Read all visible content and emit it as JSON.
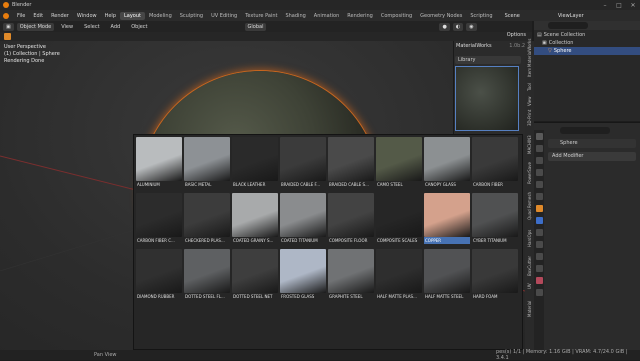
{
  "titlebar": {
    "title": "Blender",
    "minimize": "–",
    "maximize": "□",
    "close": "✕"
  },
  "menubar": {
    "menus": [
      "File",
      "Edit",
      "Render",
      "Window",
      "Help"
    ],
    "workspaces": [
      "Layout",
      "Modeling",
      "Sculpting",
      "UV Editing",
      "Texture Paint",
      "Shading",
      "Animation",
      "Rendering",
      "Compositing",
      "Geometry Nodes",
      "Scripting"
    ],
    "active_workspace": "Layout",
    "scene_label": "Scene",
    "viewlayer_label": "ViewLayer"
  },
  "viewport_header": {
    "mode": "Object Mode",
    "menus": [
      "View",
      "Select",
      "Add",
      "Object"
    ],
    "orientation": "Global",
    "options": "Options"
  },
  "viewport": {
    "info_lines": [
      "User Perspective",
      "(1) Collection | Sphere",
      "Rendering Done"
    ],
    "sidebar_tabs": [
      "MaterialWorks",
      "Item",
      "Tool",
      "View",
      "3D-Print",
      "MACHIN3",
      "PowerSave",
      "Quad Remesh",
      "HardOps",
      "BoxCutter",
      "UV",
      "Material"
    ]
  },
  "materialworks": {
    "title": "MaterialWorks",
    "version": "1.0b.2",
    "library_label": "Library"
  },
  "library": {
    "materials": [
      {
        "name": "ALUMINIUM",
        "color": "#b9bcbe"
      },
      {
        "name": "BASIC METAL",
        "color": "#8d9195"
      },
      {
        "name": "BLACK LEATHER",
        "color": "#2a2a2a"
      },
      {
        "name": "BRAIDED CABLE F...",
        "color": "#3b3b3b"
      },
      {
        "name": "BRAIDED CABLE S...",
        "color": "#4a4a4a"
      },
      {
        "name": "CAMO STEEL",
        "color": "#545a48"
      },
      {
        "name": "CANOPY GLASS",
        "color": "#8c9092"
      },
      {
        "name": "CARBON FIBER",
        "color": "#3a3a3a"
      },
      {
        "name": "CARBON FIBER C...",
        "color": "#2c2c2c"
      },
      {
        "name": "CHECKERED PLAS...",
        "color": "#3c3c3c"
      },
      {
        "name": "COATED GRAINY S...",
        "color": "#a8aaab"
      },
      {
        "name": "COATED TITANIUM",
        "color": "#8a8c8e"
      },
      {
        "name": "COMPOSITE FLOOR",
        "color": "#434343"
      },
      {
        "name": "COMPOSITE SCALES",
        "color": "#262626"
      },
      {
        "name": "COPPER",
        "color": "#d4a18c"
      },
      {
        "name": "CYBER TITANIUM",
        "color": "#505152"
      },
      {
        "name": "DIAMOND RUBBER",
        "color": "#303030"
      },
      {
        "name": "DOTTED STEEL FL...",
        "color": "#5e6062"
      },
      {
        "name": "DOTTED STEEL NET",
        "color": "#3e3e3e"
      },
      {
        "name": "FROSTED GLASS",
        "color": "#aeb7c6"
      },
      {
        "name": "GRAPHITE STEEL",
        "color": "#707274"
      },
      {
        "name": "HALF MATTE PLAS...",
        "color": "#2e2e2e"
      },
      {
        "name": "HALF MATTE STEEL",
        "color": "#515254"
      },
      {
        "name": "HARD FOAM",
        "color": "#393939"
      }
    ],
    "selected": "COPPER"
  },
  "outliner": {
    "rows": [
      "Scene Collection",
      "Collection",
      "Sphere"
    ]
  },
  "properties": {
    "object_name": "Sphere",
    "add_modifier": "Add Modifier"
  },
  "statusbar": {
    "left": "Pan View",
    "right": "pes(s) 1/1 | Memory: 1.16 GiB | VRAM: 4.7/24.0 GiB | 3.4.1"
  },
  "colors": {
    "accent": "#4772b3",
    "rim": "#c8661e",
    "active_tab": "#474747"
  }
}
